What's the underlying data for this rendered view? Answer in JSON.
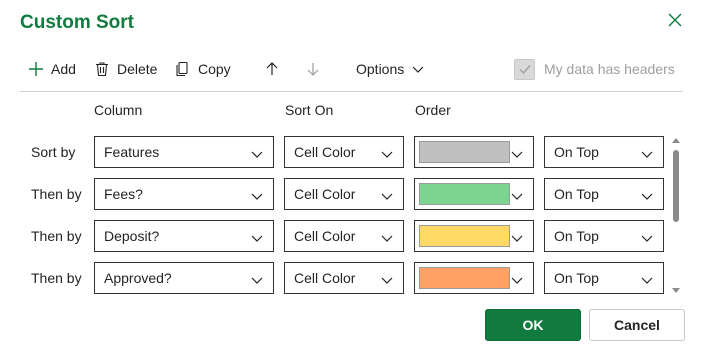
{
  "dialog": {
    "title": "Custom Sort",
    "close_icon": "close-icon"
  },
  "toolbar": {
    "add_label": "Add",
    "delete_label": "Delete",
    "copy_label": "Copy",
    "options_label": "Options",
    "move_up_icon": "arrow-up-icon",
    "move_down_icon": "arrow-down-icon"
  },
  "headers_checkbox": {
    "label": "My data has headers",
    "checked": true,
    "disabled": true
  },
  "columns": {
    "column": "Column",
    "sort_on": "Sort On",
    "order": "Order"
  },
  "rows": [
    {
      "label": "Sort by",
      "column": "Features",
      "sort_on": "Cell Color",
      "color": "#c0c0c0",
      "position": "On Top"
    },
    {
      "label": "Then by",
      "column": "Fees?",
      "sort_on": "Cell Color",
      "color": "#7bd490",
      "position": "On Top"
    },
    {
      "label": "Then by",
      "column": "Deposit?",
      "sort_on": "Cell Color",
      "color": "#ffd966",
      "position": "On Top"
    },
    {
      "label": "Then by",
      "column": "Approved?",
      "sort_on": "Cell Color",
      "color": "#ffa264",
      "position": "On Top"
    }
  ],
  "buttons": {
    "ok": "OK",
    "cancel": "Cancel"
  },
  "colors": {
    "accent": "#117a3f",
    "title": "#0f7b3f"
  }
}
